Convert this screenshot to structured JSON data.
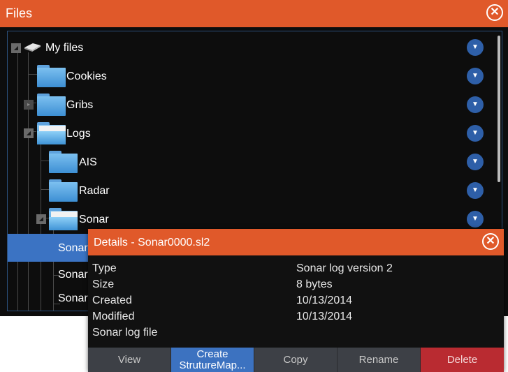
{
  "files_window": {
    "title": "Files",
    "close_icon": "close-circle-icon"
  },
  "tree": {
    "items": [
      {
        "label": "My files",
        "icon": "drive-icon",
        "expander": "expanded"
      },
      {
        "label": "Cookies",
        "icon": "folder-icon"
      },
      {
        "label": "Gribs",
        "icon": "folder-icon",
        "expander": "collapsed"
      },
      {
        "label": "Logs",
        "icon": "folder-open-icon",
        "expander": "expanded"
      },
      {
        "label": "AIS",
        "icon": "folder-icon"
      },
      {
        "label": "Radar",
        "icon": "folder-icon"
      },
      {
        "label": "Sonar",
        "icon": "folder-open-icon",
        "expander": "expanded"
      },
      {
        "label": "Sonar",
        "selected": true
      },
      {
        "label": "Sonar"
      },
      {
        "label": "Sonar"
      }
    ],
    "action_icon": "chevron-down-icon"
  },
  "details": {
    "title": "Details - Sonar0000.sl2",
    "fields": [
      {
        "label": "Type",
        "value": "Sonar log version 2"
      },
      {
        "label": "Size",
        "value": "8 bytes"
      },
      {
        "label": "Created",
        "value": "10/13/2014"
      },
      {
        "label": "Modified",
        "value": "10/13/2014"
      }
    ],
    "description": "Sonar log file",
    "buttons": {
      "view": "View",
      "create_line1": "Create",
      "create_line2": "StrutureMap...",
      "copy": "Copy",
      "rename": "Rename",
      "delete": "Delete"
    }
  },
  "colors": {
    "titlebar": "#e0592a",
    "selection": "#3b73c3",
    "action_circle": "#2e5fa8",
    "delete": "#b92b31"
  }
}
